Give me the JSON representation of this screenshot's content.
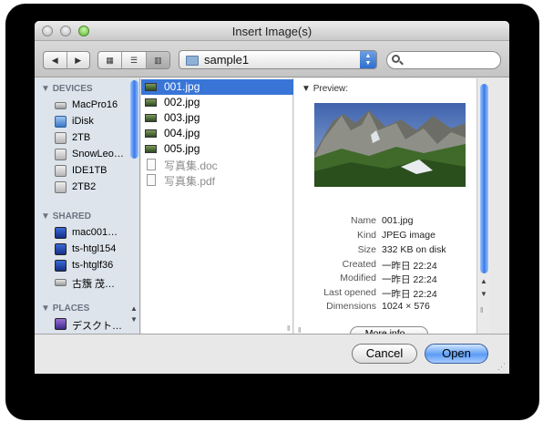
{
  "window": {
    "title": "Insert Image(s)"
  },
  "toolbar": {
    "back_icon": "back-arrow-icon",
    "forward_icon": "forward-arrow-icon",
    "view_icons": [
      "icon-view-icon",
      "list-view-icon",
      "column-view-icon"
    ],
    "folder": "sample1",
    "search_value": ""
  },
  "sidebar": {
    "devices_header": "DEVICES",
    "devices": [
      {
        "label": "MacPro16",
        "icon": "hard-drive-icon"
      },
      {
        "label": "iDisk",
        "icon": "idisk-icon"
      },
      {
        "label": "2TB",
        "icon": "external-drive-icon"
      },
      {
        "label": "SnowLeo…",
        "icon": "external-drive-icon"
      },
      {
        "label": "IDE1TB",
        "icon": "external-drive-icon"
      },
      {
        "label": "2TB2",
        "icon": "external-drive-icon"
      }
    ],
    "shared_header": "SHARED",
    "shared": [
      {
        "label": "mac001…",
        "icon": "monitor-icon"
      },
      {
        "label": "ts-htgl154",
        "icon": "monitor-icon"
      },
      {
        "label": "ts-htglf36",
        "icon": "monitor-icon"
      },
      {
        "label": "古籏 茂…",
        "icon": "network-server-icon"
      }
    ],
    "places_header": "PLACES",
    "places": [
      {
        "label": "デスクト…",
        "icon": "desktop-folder-icon"
      }
    ]
  },
  "files": [
    {
      "name": "001.jpg",
      "selected": true,
      "enabled": true,
      "icon": "jpeg-thumbnail-icon"
    },
    {
      "name": "002.jpg",
      "selected": false,
      "enabled": true,
      "icon": "jpeg-thumbnail-icon"
    },
    {
      "name": "003.jpg",
      "selected": false,
      "enabled": true,
      "icon": "jpeg-thumbnail-icon"
    },
    {
      "name": "004.jpg",
      "selected": false,
      "enabled": true,
      "icon": "jpeg-thumbnail-icon"
    },
    {
      "name": "005.jpg",
      "selected": false,
      "enabled": true,
      "icon": "jpeg-thumbnail-icon"
    },
    {
      "name": "写真集.doc",
      "selected": false,
      "enabled": false,
      "icon": "document-icon"
    },
    {
      "name": "写真集.pdf",
      "selected": false,
      "enabled": false,
      "icon": "document-icon"
    }
  ],
  "preview": {
    "header": "Preview:",
    "image_icon": "mountain-photo-preview",
    "info": [
      {
        "key": "Name",
        "value": "001.jpg"
      },
      {
        "key": "Kind",
        "value": "JPEG image"
      },
      {
        "key": "Size",
        "value": "332 KB on disk"
      },
      {
        "key": "Created",
        "value": "一昨日 22:24"
      },
      {
        "key": "Modified",
        "value": "一昨日 22:24"
      },
      {
        "key": "Last opened",
        "value": "一昨日 22:24"
      },
      {
        "key": "Dimensions",
        "value": "1024 × 576"
      }
    ],
    "more_info_label": "More info..."
  },
  "buttons": {
    "cancel": "Cancel",
    "open": "Open"
  },
  "colors": {
    "selection": "#3875d7",
    "sidebar_bg": "#dde4ec",
    "primary_button": "#5a9cf5"
  }
}
